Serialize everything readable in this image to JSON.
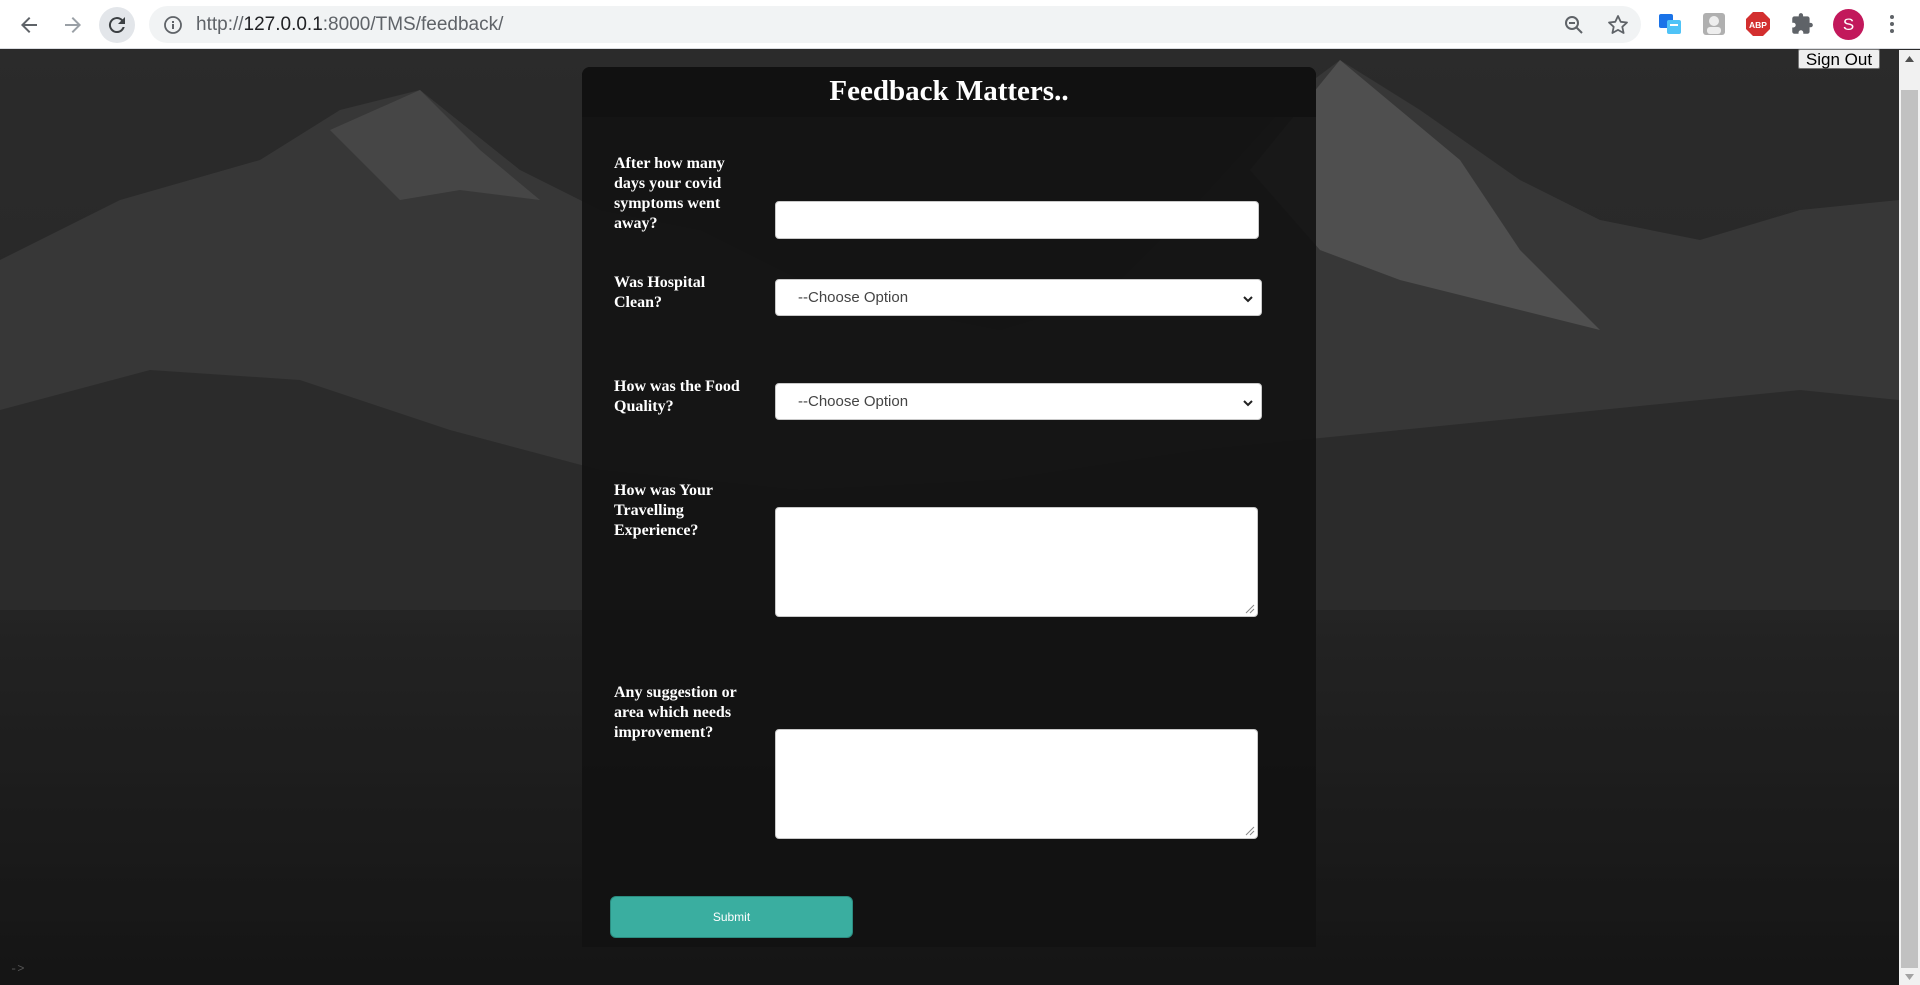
{
  "browser": {
    "url_scheme": "http://",
    "url_host": "127.0.0.1",
    "url_path": ":8000/TMS/feedback/",
    "avatar_letter": "S"
  },
  "page": {
    "signout_label": "Sign Out",
    "title": "Feedback Matters..",
    "questions": {
      "q1": "After how many days your covid symptoms went away?",
      "q2": "Was Hospital Clean?",
      "q3": "How was the Food Quality?",
      "q4": "How was Your Travelling Experience?",
      "q5": "Any suggestion or area which needs improvement?"
    },
    "select_placeholder": "--Choose Option",
    "submit_label": "Submit",
    "corner_hint": "->"
  },
  "colors": {
    "accent": "#3aaea0",
    "panel": "#121212",
    "avatar": "#c2185b"
  }
}
